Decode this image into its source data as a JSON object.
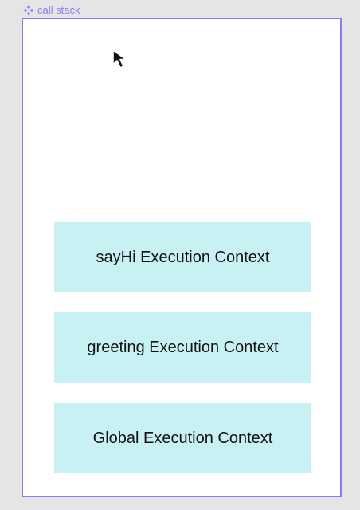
{
  "frame": {
    "label": "call stack",
    "label_icon": "component-icon",
    "accent_color": "#8b7cf6"
  },
  "stack": {
    "box_color": "#c8f1f3",
    "items": [
      {
        "label": "sayHi Execution Context"
      },
      {
        "label": "greeting Execution Context"
      },
      {
        "label": "Global Execution Context"
      }
    ]
  },
  "cursor": {
    "icon": "pointer-arrow-icon"
  }
}
